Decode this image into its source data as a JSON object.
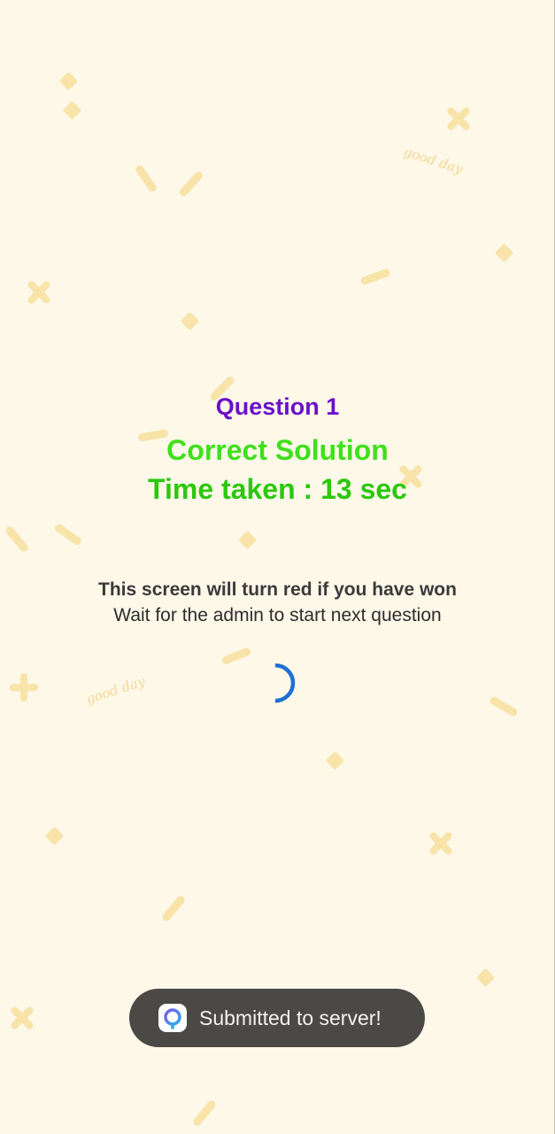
{
  "question": {
    "title": "Question 1",
    "result": "Correct Solution",
    "time_taken": "Time taken : 13 sec"
  },
  "info": {
    "line1": "This screen will turn red if you have won",
    "line2": "Wait for the admin to start next question"
  },
  "toast": {
    "message": "Submitted to server!",
    "icon": "app-logo-icon"
  },
  "background": {
    "doodle_text_1": "good day",
    "doodle_text_2": "good day"
  },
  "colors": {
    "background": "#fef8e9",
    "question_title": "#6a10c9",
    "result": "#3ee11a",
    "time_taken": "#2cc80f",
    "spinner": "#1f6fd6",
    "toast_bg": "#4a4946"
  }
}
